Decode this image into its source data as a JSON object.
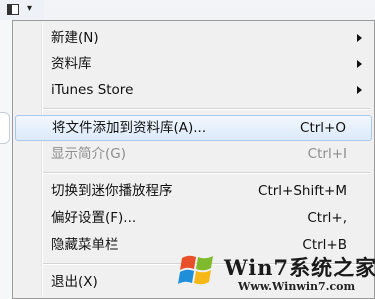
{
  "app_menu_button": {
    "icon": "app-menu-icon",
    "arrow_glyph": "▾"
  },
  "menu": {
    "items": [
      {
        "label": "新建(N)",
        "shortcut": "",
        "submenu": true,
        "disabled": false,
        "highlighted": false
      },
      {
        "label": "资料库",
        "shortcut": "",
        "submenu": true,
        "disabled": false,
        "highlighted": false
      },
      {
        "label": "iTunes Store",
        "shortcut": "",
        "submenu": true,
        "disabled": false,
        "highlighted": false
      },
      {
        "label": "将文件添加到资料库(A)...",
        "shortcut": "Ctrl+O",
        "submenu": false,
        "disabled": false,
        "highlighted": true
      },
      {
        "label": "显示简介(G)",
        "shortcut": "Ctrl+I",
        "submenu": false,
        "disabled": true,
        "highlighted": false
      },
      {
        "label": "切换到迷你播放程序",
        "shortcut": "Ctrl+Shift+M",
        "submenu": false,
        "disabled": false,
        "highlighted": false
      },
      {
        "label": "偏好设置(F)...",
        "shortcut": "Ctrl+,",
        "submenu": false,
        "disabled": false,
        "highlighted": false
      },
      {
        "label": "隐藏菜单栏",
        "shortcut": "Ctrl+B",
        "submenu": false,
        "disabled": false,
        "highlighted": false
      },
      {
        "label": "退出(X)",
        "shortcut": "",
        "submenu": false,
        "disabled": false,
        "highlighted": false
      }
    ]
  },
  "watermark": {
    "title": "Win7系统之家",
    "url": "Www.Winwin7.com"
  },
  "colors": {
    "menu_bg": "#f0f0f0",
    "highlight_border": "#a9c8ec",
    "disabled_text": "#8d8d8d"
  }
}
